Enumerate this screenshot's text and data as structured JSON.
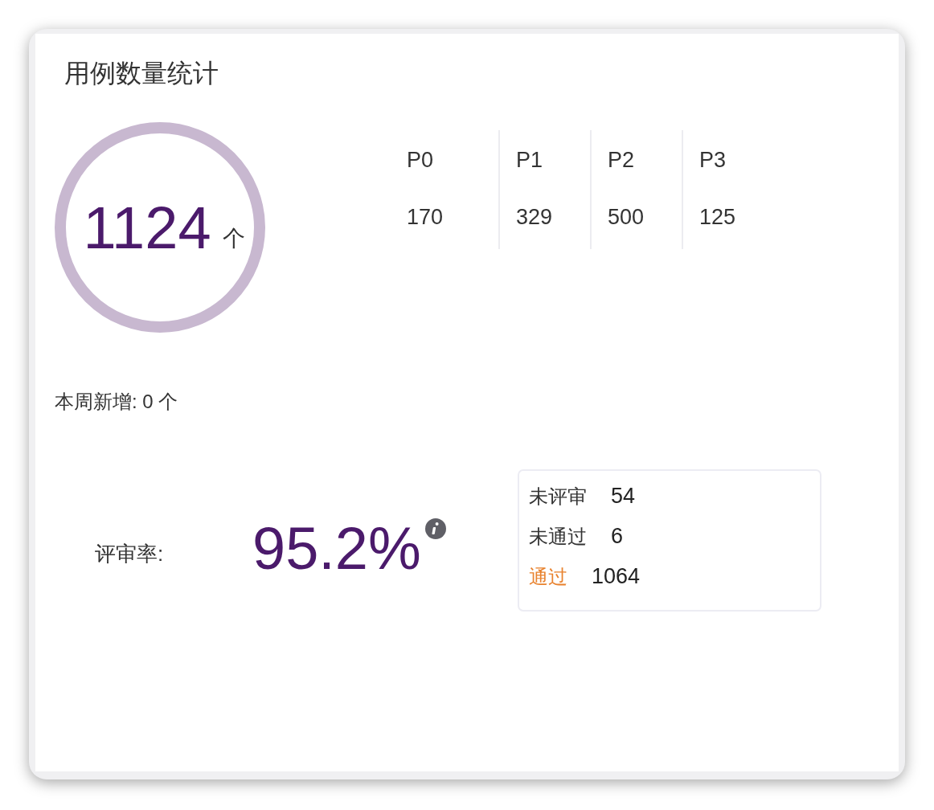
{
  "card": {
    "title": "用例数量统计"
  },
  "total": {
    "value": "1124",
    "unit": "个"
  },
  "priorities": [
    {
      "label": "P0",
      "value": "170"
    },
    {
      "label": "P1",
      "value": "329"
    },
    {
      "label": "P2",
      "value": "500"
    },
    {
      "label": "P3",
      "value": "125"
    }
  ],
  "weekly_new": "本周新增: 0 个",
  "review": {
    "label": "评审率:",
    "rate": "95.2%",
    "breakdown": [
      {
        "label": "未评审",
        "value": "54",
        "color": "#333333"
      },
      {
        "label": "未通过",
        "value": "6",
        "color": "#333333"
      },
      {
        "label": "通过",
        "value": "1064",
        "color": "#e8822e"
      }
    ]
  }
}
